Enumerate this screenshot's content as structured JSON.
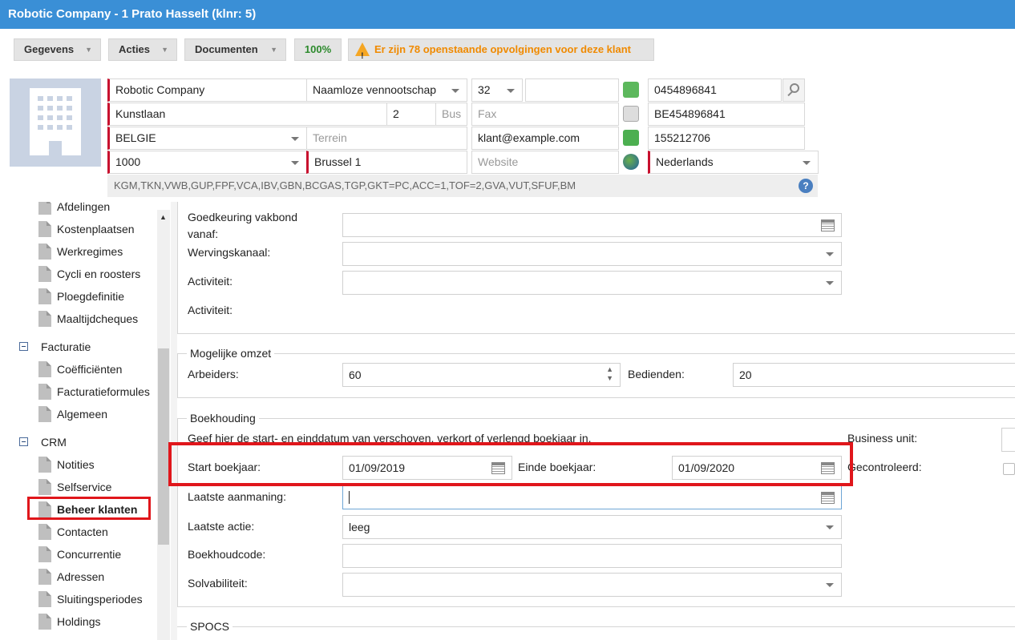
{
  "window_title": "Robotic Company - 1 Prato Hasselt (klnr: 5)",
  "toolbar": {
    "gegevens": "Gegevens",
    "acties": "Acties",
    "documenten": "Documenten",
    "zoom": "100%",
    "warning": "Er zijn 78 openstaande opvolgingen voor deze klant"
  },
  "header": {
    "company_name": "Robotic Company",
    "legal_form": "Naamloze vennootschap",
    "legal_code": "32",
    "blank1": "",
    "phone": "0454896841",
    "street": "Kunstlaan",
    "number": "2",
    "bus_placeholder": "Bus",
    "fax_placeholder": "Fax",
    "vat": "BE454896841",
    "country": "BELGIE",
    "terrain_placeholder": "Terrein",
    "email": "klant@example.com",
    "id_number": "155212706",
    "postcode": "1000",
    "city": "Brussel 1",
    "website_placeholder": "Website",
    "language": "Nederlands",
    "tags": "KGM,TKN,VWB,GUP,FPF,VCA,IBV,GBN,BCGAS,TGP,GKT=PC,ACC=1,TOF=2,GVA,VUT,SFUF,BM"
  },
  "sidebar": {
    "top_partial": "Afdelingen",
    "items_a": [
      "Kostenplaatsen",
      "Werkregimes",
      "Cycli en roosters",
      "Ploegdefinitie",
      "Maaltijdcheques"
    ],
    "group_facturatie": "Facturatie",
    "items_b": [
      "Coëfficiënten",
      "Facturatieformules",
      "Algemeen"
    ],
    "group_crm": "CRM",
    "items_c": [
      "Notities",
      "Selfservice",
      "Beheer klanten",
      "Contacten",
      "Concurrentie",
      "Adressen",
      "Sluitingsperiodes",
      "Holdings"
    ]
  },
  "form": {
    "goedkeuring_label_1": "Goedkeuring vakbond",
    "goedkeuring_label_2": "vanaf:",
    "wervingskanaal_label": "Wervingskanaal:",
    "activiteit_label": "Activiteit:",
    "activiteit2_label": "Activiteit:",
    "omzet_legend": "Mogelijke omzet",
    "arbeiders_label": "Arbeiders:",
    "arbeiders_value": "60",
    "bedienden_label": "Bedienden:",
    "bedienden_value": "20",
    "boekhouding_legend": "Boekhouding",
    "boekhouding_hint": "Geef hier de start- en einddatum van verschoven, verkort of verlengd boekjaar in.",
    "business_unit_label": "Business unit:",
    "start_label": "Start boekjaar:",
    "start_value": "01/09/2019",
    "einde_label": "Einde boekjaar:",
    "einde_value": "01/09/2020",
    "gecontroleerd_label": "Gecontroleerd:",
    "aanmaning_label": "Laatste aanmaning:",
    "actie_label": "Laatste actie:",
    "actie_value": "leeg",
    "boekhoudcode_label": "Boekhoudcode:",
    "solvabiliteit_label": "Solvabiliteit:",
    "spocs_legend": "SPOCS"
  },
  "colors": {
    "titlebar": "#3a8fd6",
    "required": "#c8102e",
    "highlight": "#e0161b",
    "warning": "#f08a00",
    "zoom": "#2c8a2c"
  }
}
